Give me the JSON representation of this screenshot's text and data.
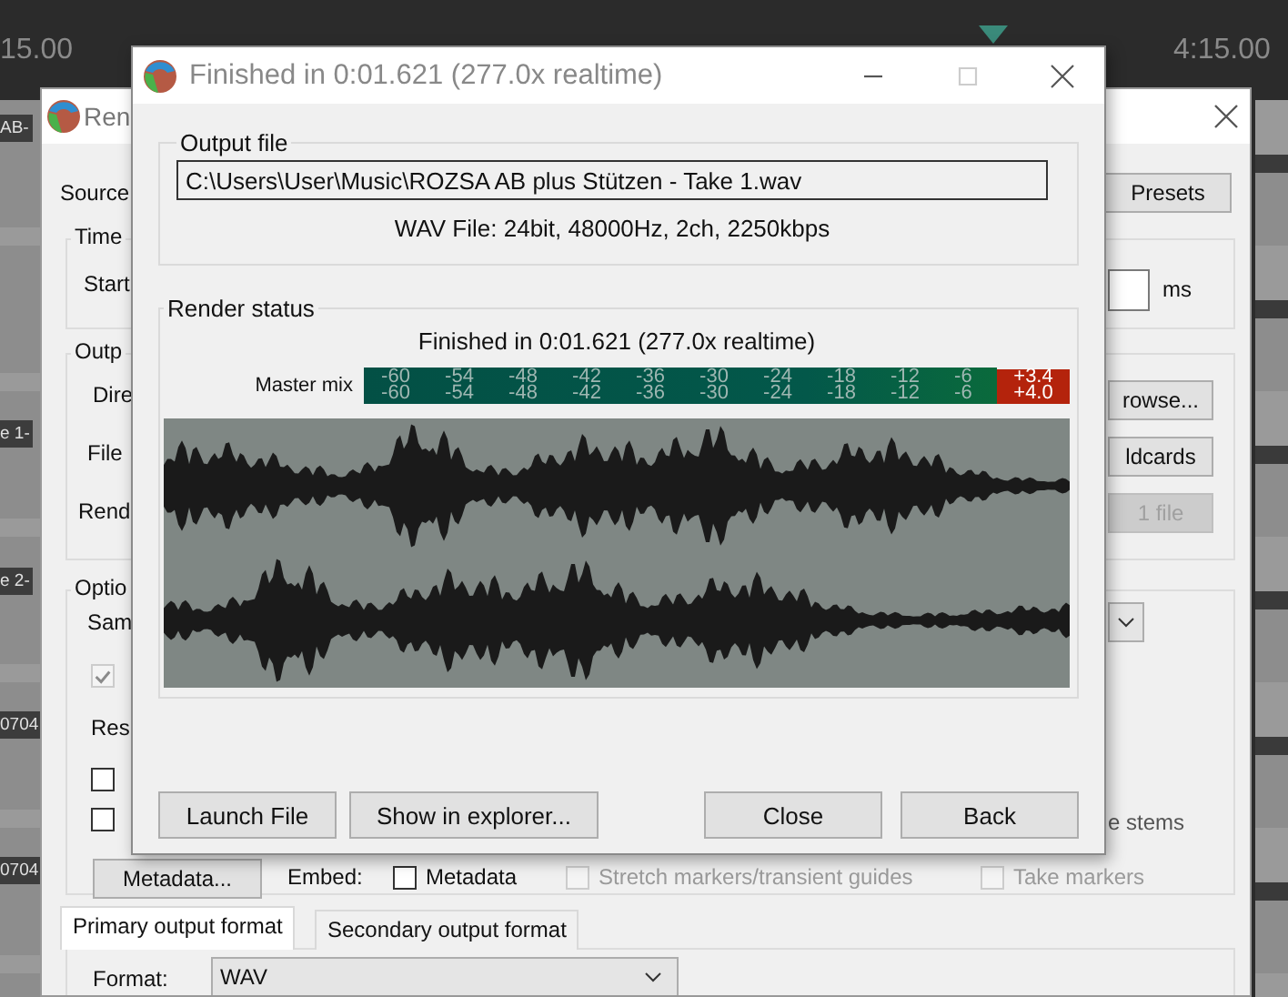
{
  "timeline": {
    "ruler": [
      "15.00",
      "4:15.00"
    ],
    "track_labels": [
      "AB-",
      "e 1-",
      "e 2-",
      "0704",
      "0704"
    ]
  },
  "render_window": {
    "title": "Ren",
    "source_label": "Source",
    "presets_button": "Presets",
    "time_group": "Time",
    "start_label": "Start",
    "unit_label": "ms",
    "output_group": "Outp",
    "directory_label": "Dire",
    "file_label": "File",
    "render_label": "Rend",
    "side_buttons": [
      {
        "label": "rowse...",
        "disabled": false
      },
      {
        "label": "ldcards",
        "disabled": false
      },
      {
        "label": "1 file",
        "disabled": true
      }
    ],
    "options_group": "Optio",
    "sample_label": "Sam",
    "use_checkbox": {
      "checked": true,
      "disabled": true
    },
    "resample_label": "Res",
    "checkboxes": [
      {
        "checked": false
      },
      {
        "checked": false
      }
    ],
    "stems_label": "e stems",
    "metadata_button": "Metadata...",
    "embed_label": "Embed:",
    "embed_options": [
      {
        "label": "Metadata",
        "checked": false,
        "disabled": false
      },
      {
        "label": "Stretch markers/transient guides",
        "checked": false,
        "disabled": true
      },
      {
        "label": "Take markers",
        "checked": false,
        "disabled": true
      }
    ],
    "tabs": [
      {
        "label": "Primary output format",
        "selected": true
      },
      {
        "label": "Secondary output format",
        "selected": false
      }
    ],
    "format_label": "Format:",
    "format_value": "WAV"
  },
  "finished_dialog": {
    "title": "Finished in 0:01.621 (277.0x realtime)",
    "output_group": "Output file",
    "path": "C:\\Users\\User\\Music\\ROZSA AB plus Stützen - Take 1.wav",
    "file_info": "WAV File: 24bit, 48000Hz, 2ch, 2250kbps",
    "status_group": "Render status",
    "status": "Finished in 0:01.621 (277.0x realtime)",
    "meter": {
      "label": "Master mix",
      "channels": [
        {
          "ticks": [
            "-60",
            "-54",
            "-48",
            "-42",
            "-36",
            "-30",
            "-24",
            "-18",
            "-12",
            "-6"
          ],
          "peak": "+3.4",
          "clipped": true
        },
        {
          "ticks": [
            "-60",
            "-54",
            "-48",
            "-42",
            "-36",
            "-30",
            "-24",
            "-18",
            "-12",
            "-6"
          ],
          "peak": "+4.0",
          "clipped": true
        }
      ]
    },
    "file_buttons": [
      "Launch File",
      "Show in explorer..."
    ],
    "dialog_buttons": [
      "Close",
      "Back"
    ]
  }
}
